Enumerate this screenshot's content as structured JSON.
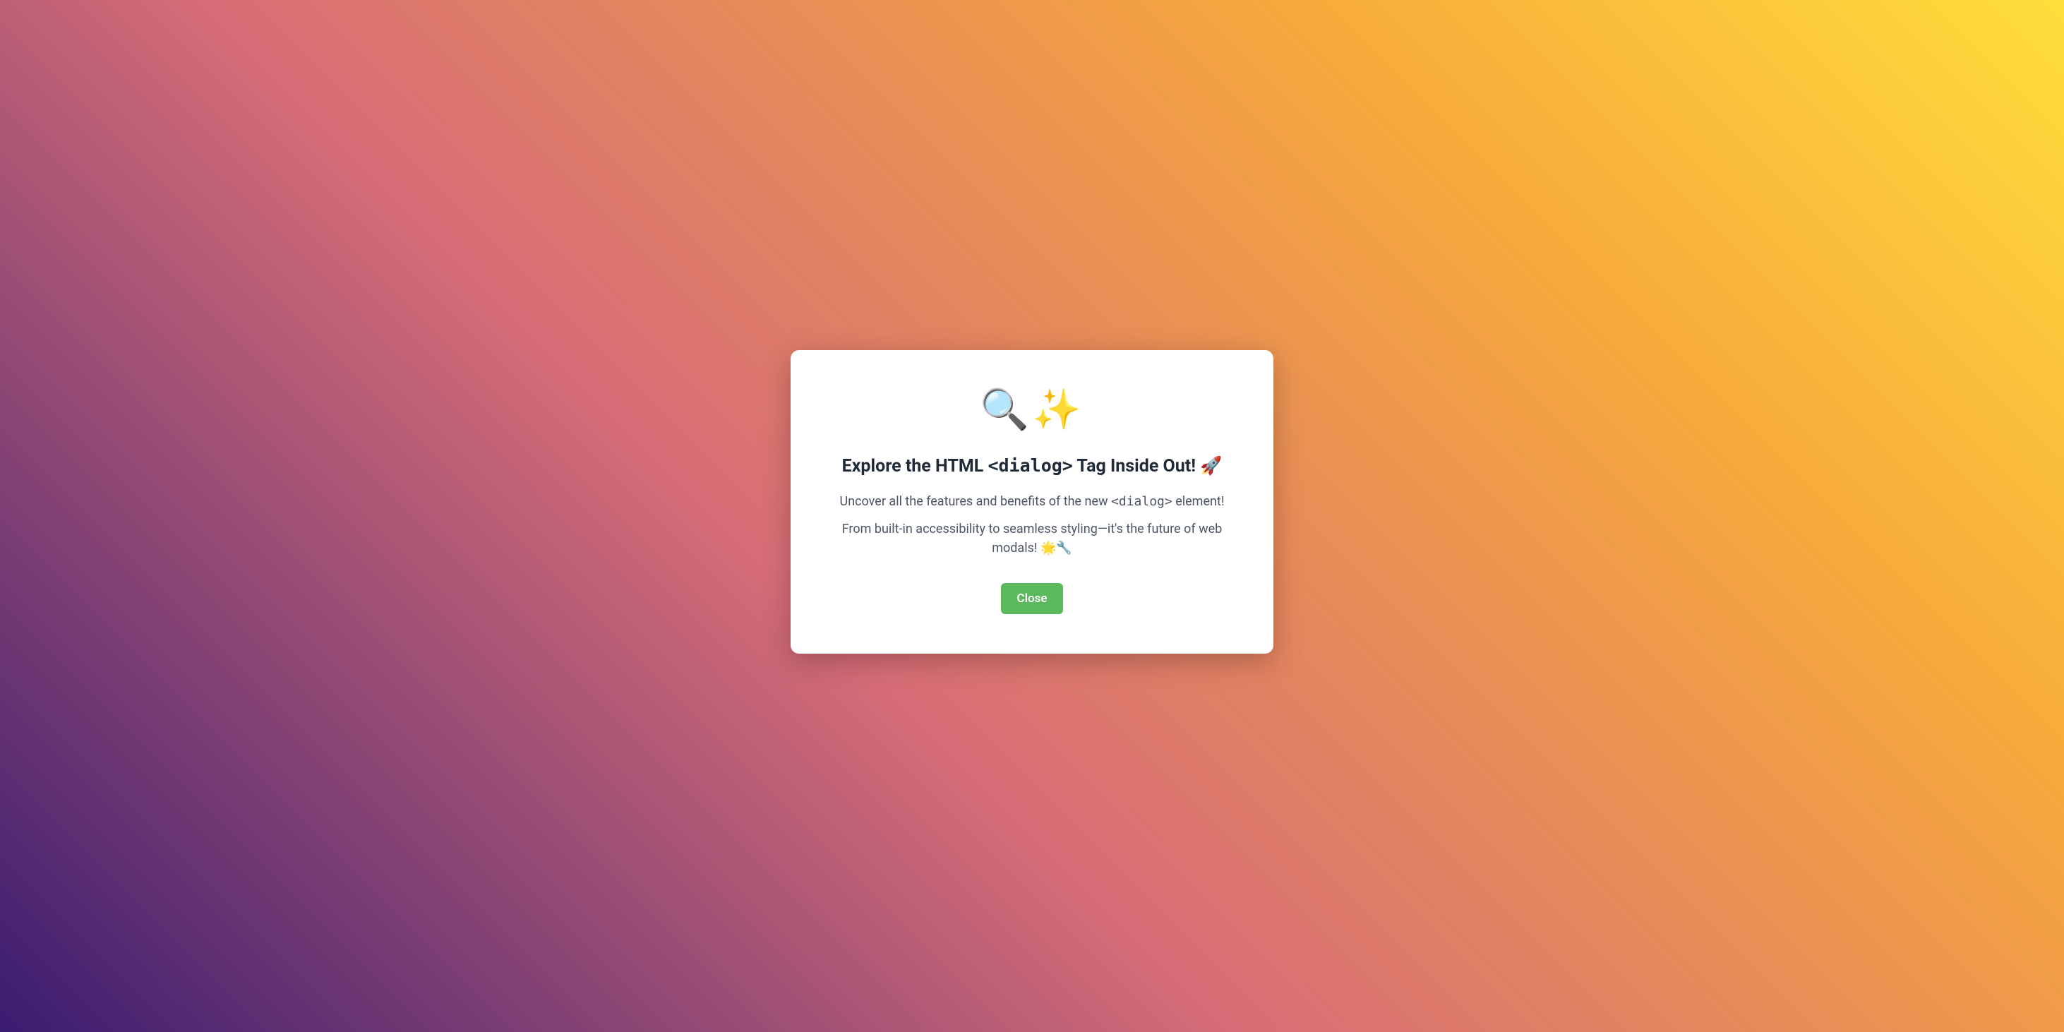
{
  "dialog": {
    "icons": "🔍✨",
    "title_prefix": "Explore the HTML ",
    "title_code": "<dialog>",
    "title_suffix": " Tag Inside Out! 🚀",
    "body1_prefix": "Uncover all the features and benefits of the new ",
    "body1_code": "<dialog>",
    "body1_suffix": " element!",
    "body2": "From built-in accessibility to seamless styling—it's the future of web modals! 🌟🔧",
    "close_label": "Close"
  }
}
